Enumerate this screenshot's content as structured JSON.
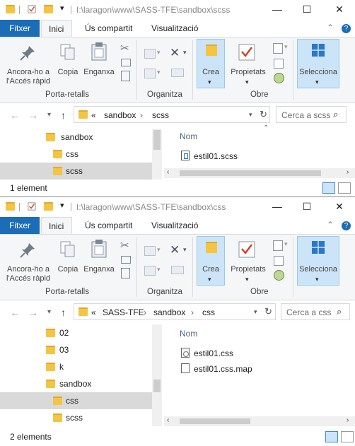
{
  "windows": [
    {
      "title": "I:\\laragon\\www\\SASS-TFE\\sandbox\\scss",
      "tabs": [
        "Fitxer",
        "Inici",
        "Ús compartit",
        "Visualització"
      ],
      "ribbon": {
        "pin_label": "Ancora-ho a l'Accés ràpid",
        "copy_label": "Copia",
        "paste_label": "Enganxa",
        "clipboard_group": "Porta-retalls",
        "organize_group": "Organitza",
        "new_label": "Crea",
        "properties_label": "Propietats",
        "open_group": "Obre",
        "select_label": "Selecciona"
      },
      "address": {
        "overflow": "«",
        "crumbs": [
          "sandbox",
          "scss"
        ]
      },
      "search_placeholder": "Cerca a scss",
      "tree": [
        {
          "label": "sandbox",
          "selected": false
        },
        {
          "label": "css",
          "selected": false
        },
        {
          "label": "scss",
          "selected": true
        }
      ],
      "column_name": "Nom",
      "files": [
        {
          "name": "estil01.scss",
          "icon": "sass-file-icon"
        }
      ],
      "status": "1 element"
    },
    {
      "title": "I:\\laragon\\www\\SASS-TFE\\sandbox\\css",
      "tabs": [
        "Fitxer",
        "Inici",
        "Ús compartit",
        "Visualització"
      ],
      "ribbon": {
        "pin_label": "Ancora-ho a l'Accés ràpid",
        "copy_label": "Copia",
        "paste_label": "Enganxa",
        "clipboard_group": "Porta-retalls",
        "organize_group": "Organitza",
        "new_label": "Crea",
        "properties_label": "Propietats",
        "open_group": "Obre",
        "select_label": "Selecciona"
      },
      "address": {
        "overflow": "«",
        "crumbs": [
          "SASS-TFE",
          "sandbox",
          "css"
        ]
      },
      "search_placeholder": "Cerca a css",
      "tree": [
        {
          "label": "02",
          "selected": false
        },
        {
          "label": "03",
          "selected": false
        },
        {
          "label": "k",
          "selected": false
        },
        {
          "label": "sandbox",
          "selected": false
        },
        {
          "label": "css",
          "selected": true
        },
        {
          "label": "scss",
          "selected": false
        }
      ],
      "column_name": "Nom",
      "files": [
        {
          "name": "estil01.css",
          "icon": "css-file-icon"
        },
        {
          "name": "estil01.css.map",
          "icon": "file-icon"
        }
      ],
      "status": "2 elements"
    }
  ],
  "colors": {
    "file_tab": "#1c6db8",
    "selection": "#cce4f7",
    "folder": "#f4c542",
    "tree_selected": "#d9d9d9"
  },
  "icons": {
    "minimize": "minimize-icon",
    "maximize": "maximize-icon",
    "close": "close-icon",
    "back": "arrow-left-icon",
    "forward": "arrow-right-icon",
    "up": "arrow-up-icon",
    "refresh": "refresh-icon",
    "search": "search-icon",
    "help": "help-icon",
    "ribbon_toggle": "chevron-up-icon"
  }
}
